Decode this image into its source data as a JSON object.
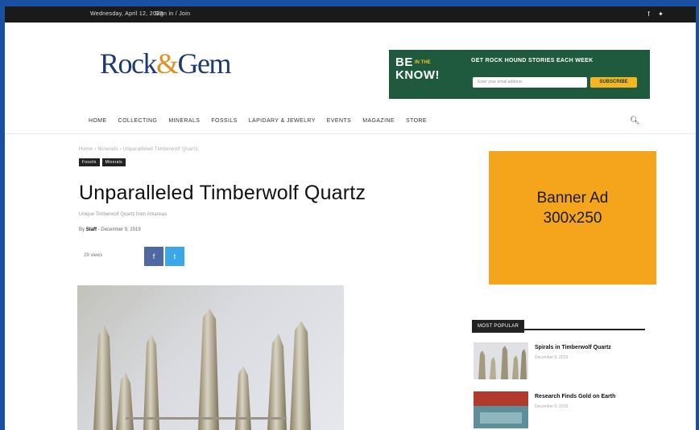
{
  "topbar": {
    "date": "Wednesday, April 12, 2023",
    "links": "Sign in / Join",
    "social_icons": [
      "facebook-icon",
      "twitter-icon"
    ]
  },
  "header": {
    "logo_left": "Rock",
    "logo_amp": "&",
    "logo_right": "Gem"
  },
  "promo": {
    "line1": "BE",
    "line1_small": "IN THE",
    "line2": "KNOW!",
    "tagline": "GET ROCK HOUND STORIES EACH WEEK",
    "email_placeholder": "Enter your email address",
    "subscribe_label": "SUBSCRIBE"
  },
  "nav": {
    "items": [
      "HOME",
      "COLLECTING",
      "MINERALS",
      "FOSSILS",
      "LAPIDARY & JEWELRY",
      "EVENTS",
      "MAGAZINE",
      "STORE"
    ],
    "search_icon": "search-icon"
  },
  "article": {
    "breadcrumb": "Home › Minerals › Unparalleled Timberwolf Quartz",
    "categories": [
      "Fossils",
      "Minerals"
    ],
    "title": "Unparalleled Timberwolf Quartz",
    "subtitle": "Unique Timberwolf Quartz from Arkansas",
    "byline_prefix": "By",
    "author": "Staff",
    "date": "- December 9, 2019",
    "views": "29 views",
    "share_facebook": "f",
    "share_twitter": "t"
  },
  "sidebar": {
    "banner_line1": "Banner Ad",
    "banner_line2": "300x250",
    "popular_header": "MOST POPULAR",
    "popular": [
      {
        "title": "Spirals in Timberwolf Quartz",
        "date": "December 9, 2019"
      },
      {
        "title": "Research Finds Gold on Earth",
        "date": "December 9, 2019"
      }
    ]
  },
  "colors": {
    "frame": "#1b4fa0",
    "logo": "#1e3a72",
    "logo_accent": "#e08f1f",
    "promo_bg": "#1f5a3e",
    "banner": "#f4a51c",
    "facebook": "#4e69a2",
    "twitter": "#3aa8e8"
  }
}
